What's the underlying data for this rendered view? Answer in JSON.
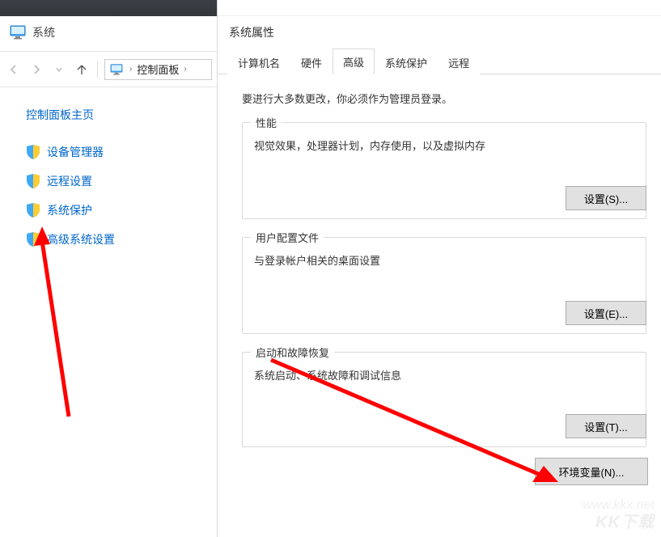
{
  "left": {
    "title": "系统",
    "breadcrumb": "控制面板",
    "sidebar_home": "控制面板主页",
    "items": [
      {
        "label": "设备管理器"
      },
      {
        "label": "远程设置"
      },
      {
        "label": "系统保护"
      },
      {
        "label": "高级系统设置"
      }
    ]
  },
  "dialog": {
    "title": "系统属性",
    "tabs": [
      {
        "label": "计算机名"
      },
      {
        "label": "硬件"
      },
      {
        "label": "高级"
      },
      {
        "label": "系统保护"
      },
      {
        "label": "远程"
      }
    ],
    "active_tab": 2,
    "admin_note": "要进行大多数更改，你必须作为管理员登录。",
    "groups": {
      "perf": {
        "title": "性能",
        "desc": "视觉效果，处理器计划，内存使用，以及虚拟内存",
        "btn": "设置(S)..."
      },
      "profile": {
        "title": "用户配置文件",
        "desc": "与登录帐户相关的桌面设置",
        "btn": "设置(E)..."
      },
      "startup": {
        "title": "启动和故障恢复",
        "desc": "系统启动、系统故障和调试信息",
        "btn": "设置(T)..."
      }
    },
    "env_btn": "环境变量(N)..."
  },
  "watermark_main": "KK下载",
  "watermark_sub": "www.kkx.net"
}
